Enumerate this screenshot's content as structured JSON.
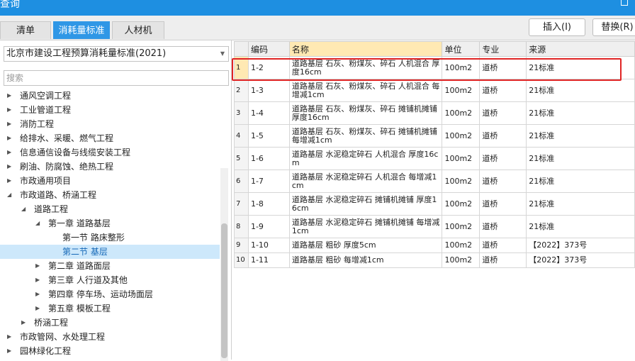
{
  "window": {
    "title": "查询"
  },
  "tabs": [
    {
      "label": "清单"
    },
    {
      "label": "消耗量标准"
    },
    {
      "label": "人材机"
    }
  ],
  "toolbar": {
    "insert_label": "插入(I)",
    "replace_label": "替换(R)"
  },
  "left": {
    "standard_selected": "北京市建设工程预算消耗量标准(2021)",
    "search_placeholder": "搜索"
  },
  "tree": [
    {
      "label": "通风空调工程",
      "depth": 0,
      "expanded": false
    },
    {
      "label": "工业管道工程",
      "depth": 0,
      "expanded": false
    },
    {
      "label": "消防工程",
      "depth": 0,
      "expanded": false
    },
    {
      "label": "给排水、采暖、燃气工程",
      "depth": 0,
      "expanded": false
    },
    {
      "label": "信息通信设备与线缆安装工程",
      "depth": 0,
      "expanded": false
    },
    {
      "label": "刷油、防腐蚀、绝热工程",
      "depth": 0,
      "expanded": false
    },
    {
      "label": "市政通用项目",
      "depth": 0,
      "expanded": false
    },
    {
      "label": "市政道路、桥涵工程",
      "depth": 0,
      "expanded": true
    },
    {
      "label": "道路工程",
      "depth": 1,
      "expanded": true
    },
    {
      "label": "第一章 道路基层",
      "depth": 2,
      "expanded": true
    },
    {
      "label": "第一节 路床整形",
      "depth": 3,
      "leaf": true
    },
    {
      "label": "第二节 基层",
      "depth": 3,
      "leaf": true,
      "selected": true
    },
    {
      "label": "第二章 道路面层",
      "depth": 2,
      "expanded": false
    },
    {
      "label": "第三章 人行道及其他",
      "depth": 2,
      "expanded": false
    },
    {
      "label": "第四章 停车场、运动场面层",
      "depth": 2,
      "expanded": false
    },
    {
      "label": "第五章 模板工程",
      "depth": 2,
      "expanded": false
    },
    {
      "label": "桥涵工程",
      "depth": 1,
      "expanded": false
    },
    {
      "label": "市政管网、水处理工程",
      "depth": 0,
      "expanded": false
    },
    {
      "label": "园林绿化工程",
      "depth": 0,
      "expanded": false
    }
  ],
  "table": {
    "columns": [
      "编码",
      "名称",
      "单位",
      "专业",
      "来源"
    ],
    "rows": [
      {
        "no": "1",
        "code": "1-2",
        "name": "道路基层 石灰、粉煤灰、碎石 人机混合 厚度16cm",
        "unit": "100m2",
        "major": "道桥",
        "source": "21标准"
      },
      {
        "no": "2",
        "code": "1-3",
        "name": "道路基层 石灰、粉煤灰、碎石 人机混合 每增减1cm",
        "unit": "100m2",
        "major": "道桥",
        "source": "21标准"
      },
      {
        "no": "3",
        "code": "1-4",
        "name": "道路基层 石灰、粉煤灰、碎石 摊铺机摊铺 厚度16cm",
        "unit": "100m2",
        "major": "道桥",
        "source": "21标准"
      },
      {
        "no": "4",
        "code": "1-5",
        "name": "道路基层 石灰、粉煤灰、碎石 摊铺机摊铺 每增减1cm",
        "unit": "100m2",
        "major": "道桥",
        "source": "21标准"
      },
      {
        "no": "5",
        "code": "1-6",
        "name": "道路基层 水泥稳定碎石 人机混合 厚度16cm",
        "unit": "100m2",
        "major": "道桥",
        "source": "21标准"
      },
      {
        "no": "6",
        "code": "1-7",
        "name": "道路基层 水泥稳定碎石 人机混合 每增减1cm",
        "unit": "100m2",
        "major": "道桥",
        "source": "21标准"
      },
      {
        "no": "7",
        "code": "1-8",
        "name": "道路基层 水泥稳定碎石 摊铺机摊铺 厚度16cm",
        "unit": "100m2",
        "major": "道桥",
        "source": "21标准"
      },
      {
        "no": "8",
        "code": "1-9",
        "name": "道路基层 水泥稳定碎石 摊铺机摊铺 每增减1cm",
        "unit": "100m2",
        "major": "道桥",
        "source": "21标准"
      },
      {
        "no": "9",
        "code": "1-10",
        "name": "道路基层 粗砂 厚度5cm",
        "unit": "100m2",
        "major": "道桥",
        "source": "【2022】373号"
      },
      {
        "no": "10",
        "code": "1-11",
        "name": "道路基层 粗砂 每增减1cm",
        "unit": "100m2",
        "major": "道桥",
        "source": "【2022】373号"
      }
    ]
  },
  "colors": {
    "accent": "#2f97e6",
    "titlebar": "#1e8fe1",
    "highlight": "#e02424",
    "header_highlight": "#ffe9b3"
  },
  "icons": {
    "collapsed": "caret-right-icon",
    "expanded": "caret-down-icon"
  }
}
